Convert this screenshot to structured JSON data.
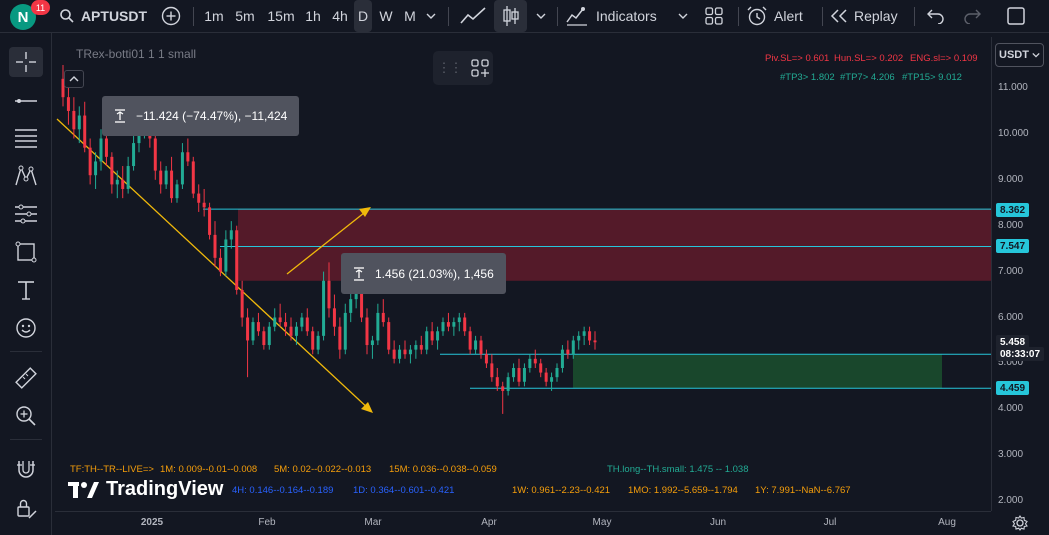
{
  "user": {
    "avatar_letter": "N",
    "notifications": "11"
  },
  "symbol": "APTUSDT",
  "intervals": [
    "1m",
    "5m",
    "15m",
    "1h",
    "4h",
    "D",
    "W",
    "M"
  ],
  "active_interval": "D",
  "toolbar": {
    "indicators_label": "Indicators",
    "alert_label": "Alert",
    "replay_label": "Replay"
  },
  "icons": {
    "add_symbol": "plus-circle-icon",
    "interval_dropdown": "chevron-down-icon",
    "line_chart": "line-chart-icon",
    "candles": "candlestick-icon",
    "indicators": "indicators-icon",
    "layouts": "grid-icon",
    "alert": "alarm-clock-icon",
    "replay": "rewind-icon",
    "undo": "undo-icon",
    "redo": "redo-icon",
    "fullscreen": "square-icon"
  },
  "currency": "USDT",
  "indicator_title": "TRex-botti01 1 1 small",
  "levels_info": {
    "piv": "Piv.SL=> 0.601",
    "hun": "Hun.SL=> 0.202",
    "eng": "ENG.sl=> 0.109",
    "tp3": "#TP3> 1.802",
    "tp7": "#TP7> 4.206",
    "tp15": "#TP15> 9.012"
  },
  "measurements": [
    {
      "text": "−11.424 (−74.47%), −11,424"
    },
    {
      "text": "1.456 (21.03%), 1,456"
    }
  ],
  "bottom_info": {
    "tf": "TF:TH--TR--LIVE=>",
    "m1": "1M: 0.009--0.01--0.008",
    "m5": "5M: 0.02--0.022--0.013",
    "m15": "15M: 0.036--0.038--0.059",
    "th": "TH.long--TH.small: 1.475 -- 1.038",
    "h4": "4H: 0.146--0.164--0.189",
    "d1": "1D: 0.364--0.601--0.421",
    "w1": "1W: 0.961--2.23--0.421",
    "mo1": "1MO: 1.992--5.659--1.794",
    "y1": "1Y: 7.991--NaN--6.767"
  },
  "logo_text": "TradingView",
  "price_axis": {
    "ticks": [
      "11.000",
      "10.000",
      "9.000",
      "8.000",
      "7.000",
      "6.000",
      "5.000",
      "4.000",
      "3.000",
      "2.000"
    ],
    "tags": [
      {
        "text": "8.362",
        "color": "#26c6da"
      },
      {
        "text": "7.547",
        "color": "#26c6da"
      },
      {
        "text": "5.458",
        "color": "#1e222d"
      },
      {
        "text": "08:33:07",
        "color": "#1e222d"
      },
      {
        "text": "4.459",
        "color": "#26c6da"
      }
    ]
  },
  "time_axis": [
    "2025",
    "Feb",
    "Mar",
    "Apr",
    "May",
    "Jun",
    "Jul",
    "Aug"
  ],
  "colors": {
    "up": "#22ab94",
    "down": "#f23645",
    "trend": "#f0b90b",
    "level_line": "#26c6da",
    "supply_zone": "#6b1c2c",
    "demand_zone": "#1b4d2e"
  },
  "chart_data": {
    "type": "candlestick",
    "candles": [
      [
        11.2,
        11.5,
        10.6,
        10.8
      ],
      [
        10.8,
        11.1,
        10.2,
        10.5
      ],
      [
        10.5,
        10.8,
        9.9,
        10.1
      ],
      [
        10.1,
        10.6,
        9.8,
        10.4
      ],
      [
        10.4,
        10.7,
        9.6,
        9.7
      ],
      [
        9.7,
        9.9,
        8.9,
        9.1
      ],
      [
        9.1,
        9.6,
        8.8,
        9.4
      ],
      [
        9.4,
        10.1,
        9.2,
        9.9
      ],
      [
        9.9,
        10.2,
        9.3,
        9.5
      ],
      [
        9.5,
        9.6,
        8.7,
        8.9
      ],
      [
        8.9,
        9.2,
        8.6,
        9.0
      ],
      [
        9.0,
        9.3,
        8.6,
        8.8
      ],
      [
        8.8,
        9.5,
        8.7,
        9.3
      ],
      [
        9.3,
        10.0,
        9.2,
        9.8
      ],
      [
        9.8,
        10.3,
        9.6,
        10.1
      ],
      [
        10.1,
        10.4,
        9.9,
        10.2
      ],
      [
        10.2,
        10.5,
        9.7,
        9.9
      ],
      [
        9.9,
        10.1,
        9.0,
        9.2
      ],
      [
        9.2,
        9.4,
        8.7,
        8.9
      ],
      [
        8.9,
        9.3,
        8.8,
        9.2
      ],
      [
        9.2,
        9.5,
        8.5,
        8.6
      ],
      [
        8.6,
        9.0,
        8.5,
        8.9
      ],
      [
        8.9,
        9.8,
        8.8,
        9.6
      ],
      [
        9.6,
        9.9,
        9.3,
        9.4
      ],
      [
        9.4,
        9.5,
        8.6,
        8.7
      ],
      [
        8.7,
        8.9,
        8.3,
        8.5
      ],
      [
        8.5,
        8.8,
        8.2,
        8.4
      ],
      [
        8.4,
        8.5,
        7.7,
        7.8
      ],
      [
        7.8,
        8.1,
        7.1,
        7.3
      ],
      [
        7.3,
        7.5,
        6.9,
        7.0
      ],
      [
        7.0,
        7.9,
        6.9,
        7.7
      ],
      [
        7.7,
        8.1,
        7.5,
        7.9
      ],
      [
        7.9,
        8.0,
        6.5,
        6.6
      ],
      [
        6.6,
        6.8,
        5.8,
        6.0
      ],
      [
        6.0,
        6.2,
        4.7,
        5.5
      ],
      [
        5.5,
        6.0,
        5.4,
        5.9
      ],
      [
        5.9,
        6.1,
        5.6,
        5.7
      ],
      [
        5.7,
        5.8,
        5.3,
        5.4
      ],
      [
        5.4,
        5.9,
        5.3,
        5.8
      ],
      [
        5.8,
        6.2,
        5.7,
        6.0
      ],
      [
        6.0,
        6.3,
        5.8,
        5.9
      ],
      [
        5.9,
        6.1,
        5.6,
        5.8
      ],
      [
        5.8,
        6.0,
        5.5,
        5.6
      ],
      [
        5.6,
        5.9,
        5.4,
        5.8
      ],
      [
        5.8,
        6.1,
        5.7,
        6.0
      ],
      [
        6.0,
        6.2,
        5.6,
        5.7
      ],
      [
        5.7,
        5.8,
        5.2,
        5.3
      ],
      [
        5.3,
        5.7,
        5.2,
        5.6
      ],
      [
        5.6,
        7.0,
        5.5,
        6.8
      ],
      [
        6.8,
        7.2,
        6.0,
        6.2
      ],
      [
        6.2,
        6.5,
        5.6,
        5.8
      ],
      [
        5.8,
        6.0,
        5.1,
        5.3
      ],
      [
        5.3,
        6.3,
        5.2,
        6.1
      ],
      [
        6.1,
        6.6,
        5.9,
        6.4
      ],
      [
        6.4,
        6.9,
        6.2,
        6.7
      ],
      [
        6.7,
        6.8,
        5.9,
        6.0
      ],
      [
        6.0,
        6.2,
        5.2,
        5.4
      ],
      [
        5.4,
        5.6,
        5.1,
        5.5
      ],
      [
        5.5,
        6.3,
        5.4,
        6.1
      ],
      [
        6.1,
        6.4,
        5.8,
        5.9
      ],
      [
        5.9,
        6.0,
        5.2,
        5.3
      ],
      [
        5.3,
        5.5,
        5.0,
        5.1
      ],
      [
        5.1,
        5.4,
        5.0,
        5.3
      ],
      [
        5.3,
        5.5,
        5.1,
        5.2
      ],
      [
        5.2,
        5.4,
        5.0,
        5.3
      ],
      [
        5.3,
        5.5,
        5.1,
        5.4
      ],
      [
        5.4,
        5.6,
        5.2,
        5.3
      ],
      [
        5.3,
        5.8,
        5.2,
        5.7
      ],
      [
        5.7,
        5.9,
        5.4,
        5.5
      ],
      [
        5.5,
        5.8,
        5.3,
        5.7
      ],
      [
        5.7,
        6.0,
        5.6,
        5.9
      ],
      [
        5.9,
        6.1,
        5.7,
        5.8
      ],
      [
        5.8,
        6.0,
        5.6,
        5.9
      ],
      [
        5.9,
        6.1,
        5.7,
        6.0
      ],
      [
        6.0,
        6.1,
        5.6,
        5.7
      ],
      [
        5.7,
        5.8,
        5.2,
        5.3
      ],
      [
        5.3,
        5.6,
        5.2,
        5.5
      ],
      [
        5.5,
        5.6,
        5.1,
        5.2
      ],
      [
        5.2,
        5.3,
        4.9,
        5.0
      ],
      [
        5.0,
        5.2,
        4.6,
        4.7
      ],
      [
        4.7,
        4.9,
        4.4,
        4.5
      ],
      [
        4.5,
        4.6,
        3.9,
        4.4
      ],
      [
        4.4,
        4.8,
        4.3,
        4.7
      ],
      [
        4.7,
        5.0,
        4.6,
        4.9
      ],
      [
        4.9,
        5.1,
        4.5,
        4.6
      ],
      [
        4.6,
        5.0,
        4.5,
        4.9
      ],
      [
        4.9,
        5.2,
        4.8,
        5.1
      ],
      [
        5.1,
        5.3,
        4.9,
        5.0
      ],
      [
        5.0,
        5.1,
        4.7,
        4.8
      ],
      [
        4.8,
        4.9,
        4.5,
        4.6
      ],
      [
        4.6,
        4.8,
        4.4,
        4.7
      ],
      [
        4.7,
        5.0,
        4.6,
        4.9
      ],
      [
        4.9,
        5.4,
        4.8,
        5.3
      ],
      [
        5.3,
        5.5,
        5.1,
        5.2
      ],
      [
        5.2,
        5.6,
        5.1,
        5.5
      ],
      [
        5.5,
        5.7,
        5.3,
        5.6
      ],
      [
        5.6,
        5.8,
        5.4,
        5.7
      ],
      [
        5.7,
        5.8,
        5.4,
        5.5
      ],
      [
        5.5,
        5.7,
        5.3,
        5.46
      ]
    ],
    "xlabels": [
      "2025",
      "Feb",
      "Mar",
      "Apr",
      "May",
      "Jun",
      "Jul",
      "Aug"
    ],
    "ylim": [
      1.8,
      11.9
    ],
    "levels": [
      8.362,
      7.547,
      5.458,
      4.459
    ],
    "zones": [
      {
        "name": "supply",
        "from": 6.8,
        "to": 8.362
      },
      {
        "name": "demand",
        "from": 4.459,
        "to": 5.2
      }
    ]
  }
}
